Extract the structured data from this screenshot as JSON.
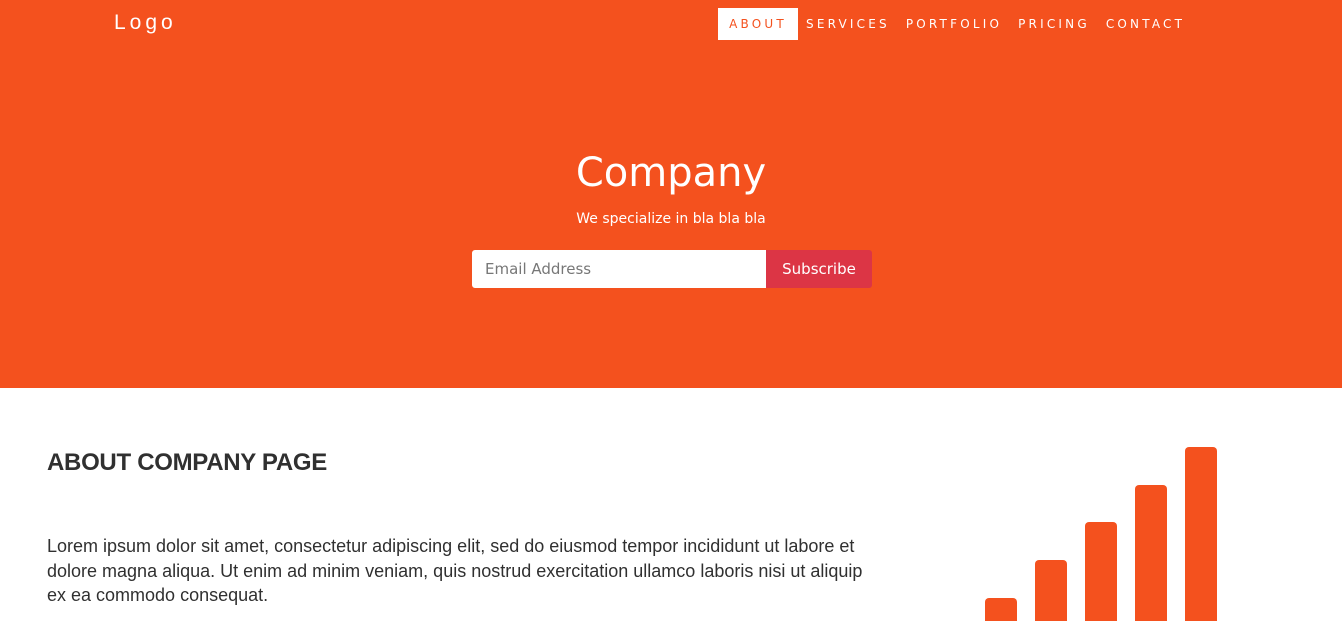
{
  "header": {
    "logo": "Logo",
    "nav": [
      {
        "label": "ABOUT"
      },
      {
        "label": "SERVICES"
      },
      {
        "label": "PORTFOLIO"
      },
      {
        "label": "PRICING"
      },
      {
        "label": "CONTACT"
      }
    ]
  },
  "hero": {
    "title": "Company",
    "tagline": "We specialize in bla bla bla",
    "email_placeholder": "Email Address",
    "email_value": "",
    "subscribe_label": "Subscribe"
  },
  "about": {
    "heading": "ABOUT COMPANY PAGE",
    "body": "Lorem ipsum dolor sit amet, consectetur adipiscing elit, sed do eiusmod tempor incididunt ut labore et dolore magna aliqua. Ut enim ad minim veniam, quis nostrud exercitation ullamco laboris nisi ut aliquip ex ea commodo consequat.",
    "icon": "signal-icon"
  },
  "colors": {
    "brand": "#f4511e",
    "subscribe": "#dc3545",
    "text": "#303030"
  }
}
